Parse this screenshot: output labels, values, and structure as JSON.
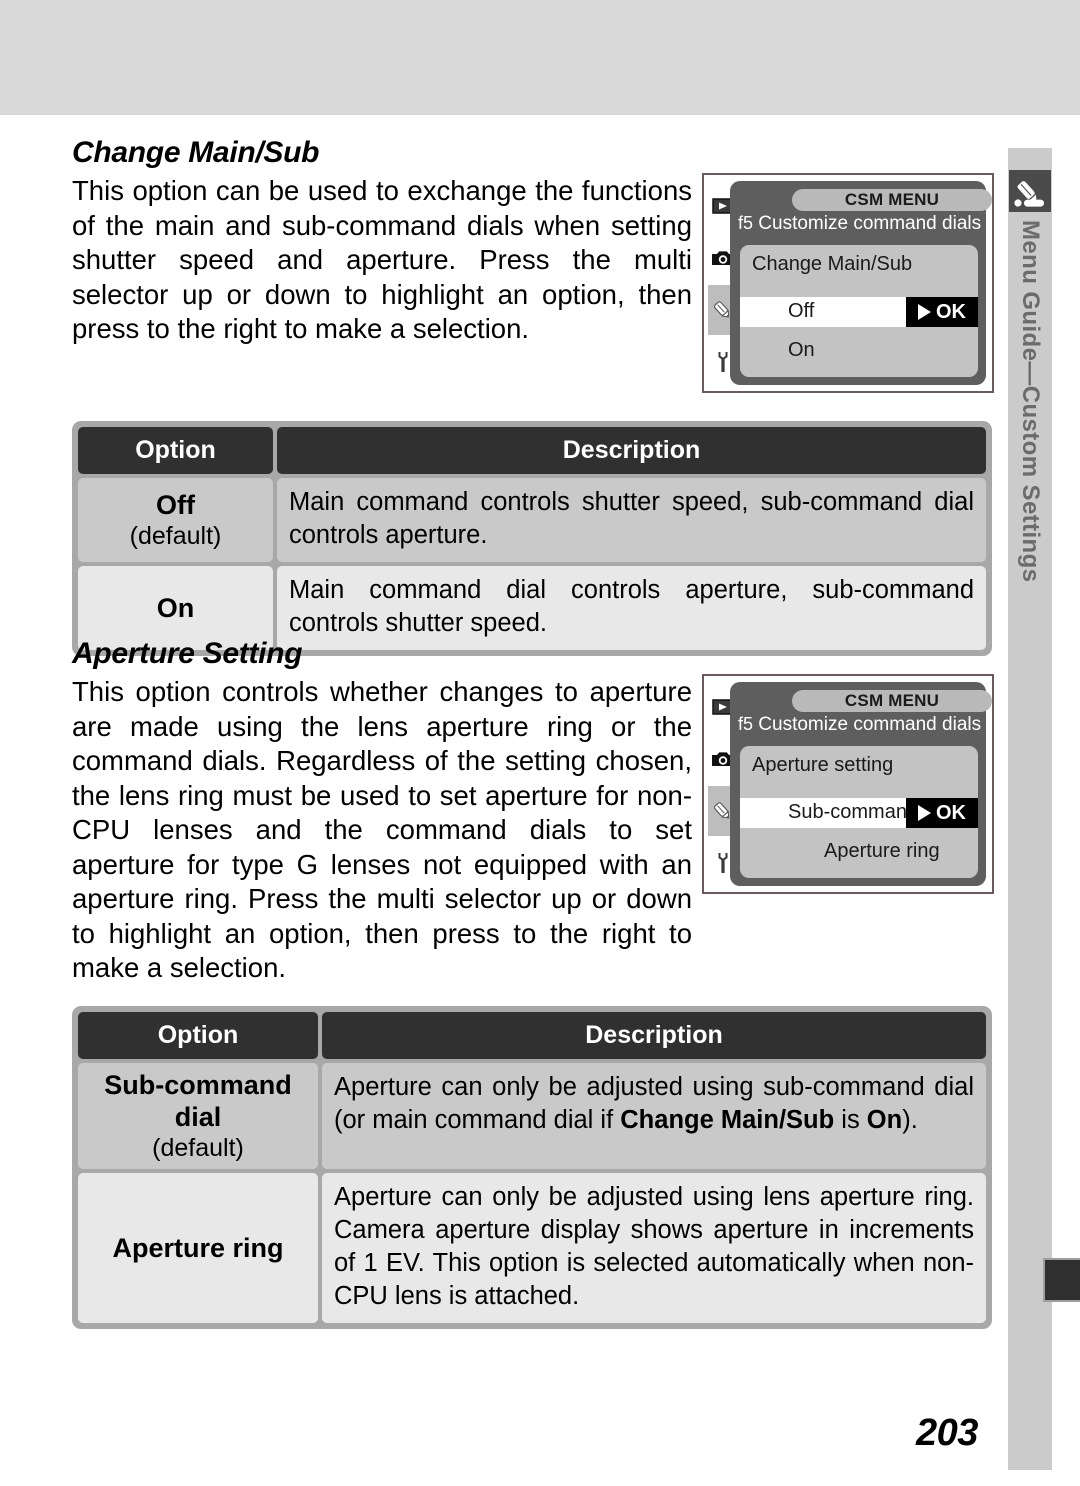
{
  "side_tab": {
    "label": "Menu Guide—Custom Settings",
    "icon": "pencil-icon"
  },
  "page_number": "203",
  "sections": [
    {
      "heading": "Change Main/Sub",
      "body": "This option can be used to exchange the functions of the main and sub-command dials when setting shutter speed and aperture.  Press the multi selector up or down to highlight an option, then press to the right to make a selection.",
      "lcd": {
        "menu_title": "CSM MENU",
        "item_number": "f5",
        "item_name": "Customize command dials",
        "panel_title": "Change Main/Sub",
        "selected_option": "Off",
        "ok_label": "OK",
        "other_option": "On",
        "tabs": [
          "playback-icon",
          "camera-icon",
          "pencil-icon",
          "wrench-icon"
        ]
      },
      "table": {
        "headers": [
          "Option",
          "Description"
        ],
        "rows": [
          {
            "option": "Off",
            "option_note": "(default)",
            "description": "Main command controls shutter speed, sub-command dial controls aperture."
          },
          {
            "option": "On",
            "option_note": "",
            "description": "Main command dial controls aperture, sub-command controls shutter speed."
          }
        ]
      }
    },
    {
      "heading": "Aperture Setting",
      "body": "This option controls whether changes to aperture are made using the lens aperture ring or the command dials.  Regardless of the setting chosen, the lens ring must be used to set aperture for non-CPU lenses and the command dials to set aperture for type G lenses not equipped with an aperture ring.  Press the multi selector up or down to highlight an option, then press to the right to make a selection.",
      "lcd": {
        "menu_title": "CSM MENU",
        "item_number": "f5",
        "item_name": "Customize command dials",
        "panel_title": "Aperture setting",
        "selected_option": "Sub-command d",
        "ok_label": "OK",
        "other_option": "Aperture ring",
        "tabs": [
          "playback-icon",
          "camera-icon",
          "pencil-icon",
          "wrench-icon"
        ]
      },
      "table": {
        "headers": [
          "Option",
          "Description"
        ],
        "rows": [
          {
            "option": "Sub-command dial",
            "option_note": "(default)",
            "description_parts": [
              {
                "text": "Aperture can only be adjusted using sub-command dial (or main command dial if ",
                "bold": false
              },
              {
                "text": "Change Main/Sub",
                "bold": true
              },
              {
                "text": " is ",
                "bold": false
              },
              {
                "text": "On",
                "bold": true
              },
              {
                "text": ").",
                "bold": false
              }
            ]
          },
          {
            "option": "Aperture ring",
            "option_note": "",
            "description": "Aperture can only be adjusted using lens aperture ring.  Camera aperture display shows aperture in increments of 1 EV. This option is selected automatically when non-CPU lens is attached."
          }
        ]
      }
    }
  ]
}
